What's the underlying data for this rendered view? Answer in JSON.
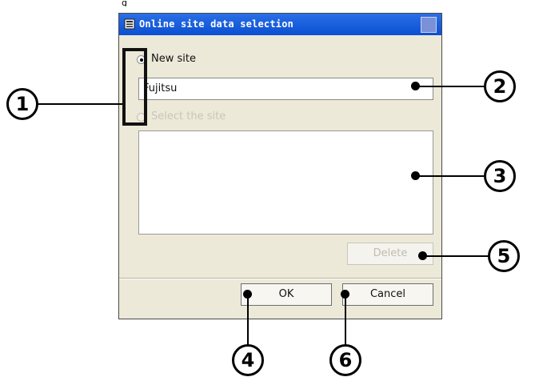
{
  "top_fragment": "g",
  "window": {
    "title": "Online site data selection"
  },
  "options": {
    "new_site_label": "New site",
    "select_site_label": "Select the site",
    "new_site_value": "Fujitsu",
    "selected": "new_site"
  },
  "site_list": [],
  "buttons": {
    "delete": "Delete",
    "ok": "OK",
    "cancel": "Cancel"
  },
  "callouts": {
    "c1": "1",
    "c2": "2",
    "c3": "3",
    "c4": "4",
    "c5": "5",
    "c6": "6"
  },
  "colors": {
    "titlebar": "#0a4fd1",
    "dialog_bg": "#ece9d8"
  }
}
